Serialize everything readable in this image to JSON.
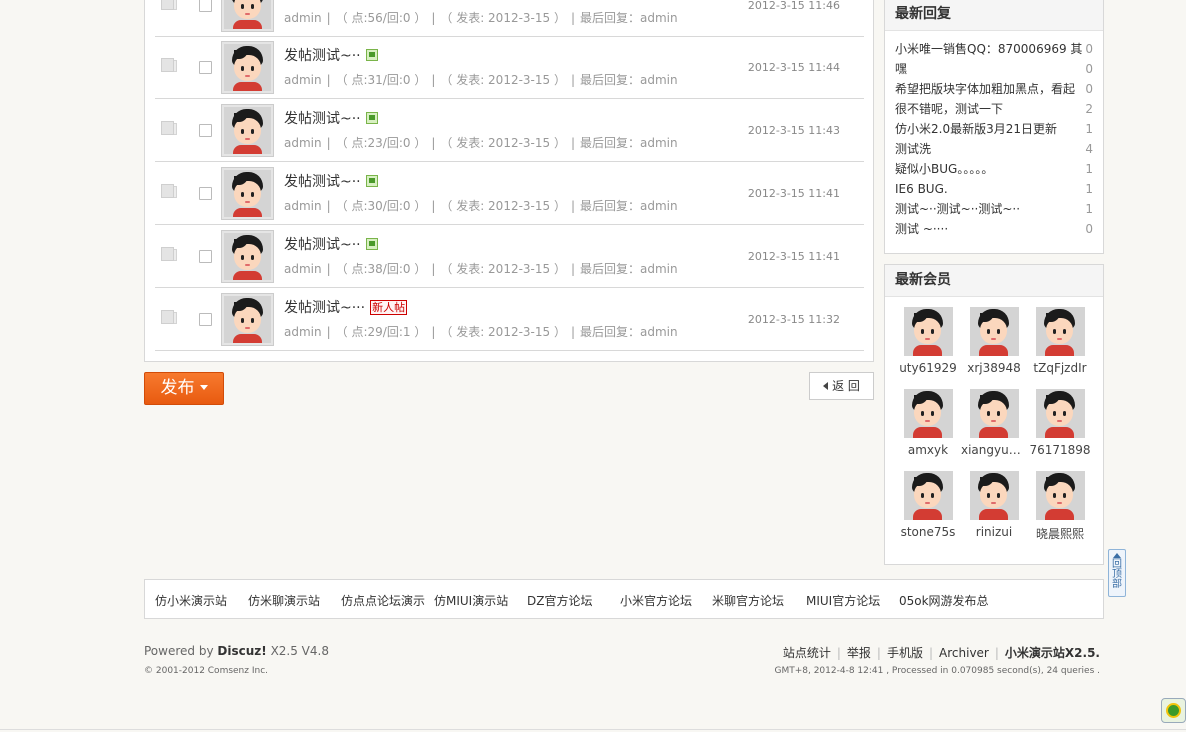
{
  "threads": [
    {
      "title": "",
      "badge": "",
      "author": "admin",
      "views": "（ 点:56/回:0 ）",
      "posted": "（ 发表: 2012-3-15 ）",
      "last_reply": "最后回复：admin",
      "time": "2012-3-15 11:46"
    },
    {
      "title": "发帖测试~··",
      "badge": "image",
      "author": "admin",
      "views": "（ 点:31/回:0 ）",
      "posted": "（ 发表: 2012-3-15 ）",
      "last_reply": "最后回复：admin",
      "time": "2012-3-15 11:44"
    },
    {
      "title": "发帖测试~··",
      "badge": "image",
      "author": "admin",
      "views": "（ 点:23/回:0 ）",
      "posted": "（ 发表: 2012-3-15 ）",
      "last_reply": "最后回复：admin",
      "time": "2012-3-15 11:43"
    },
    {
      "title": "发帖测试~··",
      "badge": "image",
      "author": "admin",
      "views": "（ 点:30/回:0 ）",
      "posted": "（ 发表: 2012-3-15 ）",
      "last_reply": "最后回复：admin",
      "time": "2012-3-15 11:41"
    },
    {
      "title": "发帖测试~··",
      "badge": "image",
      "author": "admin",
      "views": "（ 点:38/回:0 ）",
      "posted": "（ 发表: 2012-3-15 ）",
      "last_reply": "最后回复：admin",
      "time": "2012-3-15 11:41"
    },
    {
      "title": "发帖测试~···",
      "badge": "新人帖",
      "author": "admin",
      "views": "（ 点:29/回:1 ）",
      "posted": "（ 发表: 2012-3-15 ）",
      "last_reply": "最后回复：admin",
      "time": "2012-3-15 11:32"
    }
  ],
  "toolbar": {
    "post_label": "发布",
    "back_label": "返 回"
  },
  "latest_replies": {
    "title": "最新回复",
    "items": [
      {
        "text": "小米唯一销售QQ：870006969 其",
        "count": "0"
      },
      {
        "text": "嘿",
        "count": "0"
      },
      {
        "text": "希望把版块字体加粗加黑点，看起",
        "count": "0"
      },
      {
        "text": "很不错呢，测试一下",
        "count": "2"
      },
      {
        "text": "仿小米2.0最新版3月21日更新",
        "count": "1"
      },
      {
        "text": "测试洗",
        "count": "4"
      },
      {
        "text": "疑似小BUG。。。。。",
        "count": "1"
      },
      {
        "text": "IE6 BUG.",
        "count": "1"
      },
      {
        "text": "测试~··测试~··测试~··",
        "count": "1"
      },
      {
        "text": "测试 ~····",
        "count": "0"
      }
    ]
  },
  "latest_members": {
    "title": "最新会员",
    "items": [
      "uty61929",
      "xrj38948",
      "tZqFjzdIr",
      "amxyk",
      "xiangyun...",
      "76171898",
      "stone75s",
      "rinizui",
      "晓晨熙熙"
    ]
  },
  "back_top": {
    "label": "回顶部"
  },
  "links": [
    "仿小米演示站",
    "仿米聊演示站",
    "仿点点论坛演示",
    "仿MIUI演示站",
    "DZ官方论坛",
    "小米官方论坛",
    "米聊官方论坛",
    "MIUI官方论坛",
    "05ok网游发布总"
  ],
  "footer": {
    "powered_prefix": "Powered by",
    "powered_brand": "Discuz!",
    "powered_version": "X2.5 V4.8",
    "copyright": "© 2001-2012 Comsenz Inc.",
    "nav": [
      "站点统计",
      "举报",
      "手机版",
      "Archiver"
    ],
    "site_name": "小米演示站X2.5.",
    "gmt": "GMT+8, 2012-4-8 12:41 , Processed in 0.070985 second(s), 24 queries ."
  },
  "colors": {
    "accent": "#f06a20",
    "link": "#333333",
    "muted": "#999999",
    "badge": "#cc0000"
  }
}
